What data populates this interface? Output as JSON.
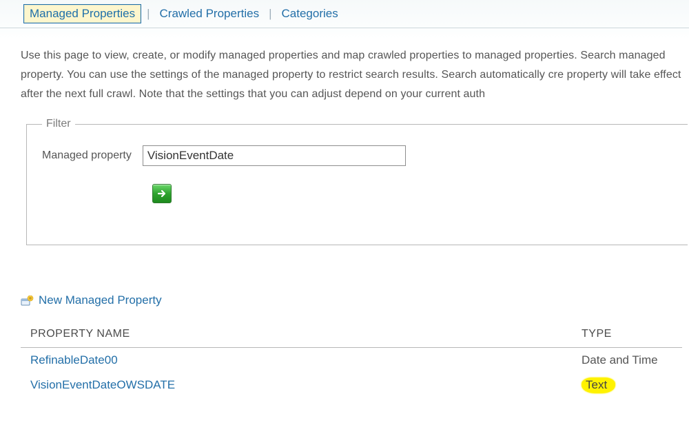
{
  "tabs": {
    "managed": "Managed Properties",
    "crawled": "Crawled Properties",
    "categories": "Categories"
  },
  "description": "Use this page to view, create, or modify managed properties and map crawled properties to managed properties. Search managed property. You can use the settings of the managed property to restrict search results. Search automatically cre property will take effect after the next full crawl. Note that the settings that you can adjust depend on your current auth",
  "filter": {
    "legend": "Filter",
    "label": "Managed property",
    "value": "VisionEventDate"
  },
  "newPropLabel": "New Managed Property",
  "columns": {
    "name": "PROPERTY NAME",
    "type": "TYPE"
  },
  "rows": [
    {
      "name": "RefinableDate00",
      "type": "Date and Time",
      "highlight": false
    },
    {
      "name": "VisionEventDateOWSDATE",
      "type": "Text",
      "highlight": true
    }
  ]
}
